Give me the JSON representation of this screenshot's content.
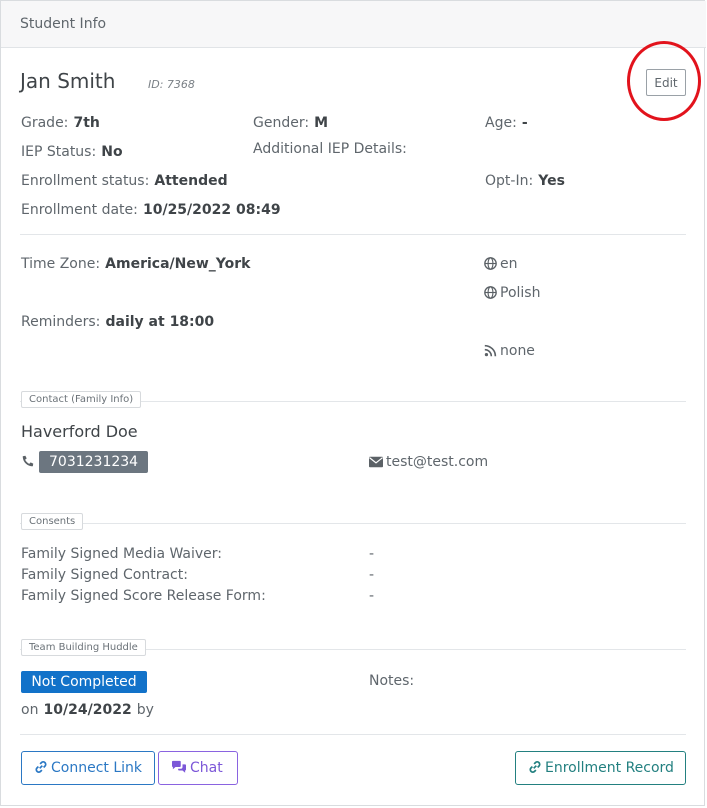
{
  "header": {
    "title": "Student Info"
  },
  "student": {
    "name": "Jan Smith",
    "id_text": "ID: 7368",
    "edit_label": "Edit",
    "grade_label": "Grade:",
    "grade": "7th",
    "gender_label": "Gender:",
    "gender": "M",
    "age_label": "Age:",
    "age": "-",
    "iep_label": "IEP Status:",
    "iep": "No",
    "iep_details_label": "Additional IEP Details:",
    "enroll_status_label": "Enrollment status:",
    "enroll_status": "Attended",
    "optin_label": "Opt-In:",
    "optin": "Yes",
    "enroll_date_label": "Enrollment date:",
    "enroll_date": "10/25/2022 08:49"
  },
  "settings": {
    "timezone_label": "Time Zone:",
    "timezone": "America/New_York",
    "lang1": "en",
    "lang2": "Polish",
    "reminders_label": "Reminders:",
    "reminders": "daily at 18:00",
    "feed": "none"
  },
  "contact": {
    "legend": "Contact (Family Info)",
    "name": "Haverford Doe",
    "phone": "7031231234",
    "email": "test@test.com"
  },
  "consents": {
    "legend": "Consents",
    "rows": [
      {
        "label": "Family Signed Media Waiver:",
        "value": "-"
      },
      {
        "label": "Family Signed Contract:",
        "value": "-"
      },
      {
        "label": "Family Signed Score Release Form:",
        "value": "-"
      }
    ]
  },
  "huddle": {
    "legend": "Team Building Huddle",
    "status": "Not Completed",
    "on_prefix": "on",
    "date": "10/24/2022",
    "by": "by",
    "notes_label": "Notes:"
  },
  "buttons": {
    "connect_link": "Connect Link",
    "chat": "Chat",
    "enrollment_record": "Enrollment Record"
  },
  "colors": {
    "accent_blue": "#1272c9",
    "annotation_red": "#e2131c",
    "badge_gray": "#6c7680",
    "purple": "#7c57d8",
    "teal": "#238080"
  },
  "icons": [
    "globe-icon",
    "rss-icon",
    "phone-icon",
    "envelope-icon",
    "link-icon",
    "chat-icon"
  ]
}
